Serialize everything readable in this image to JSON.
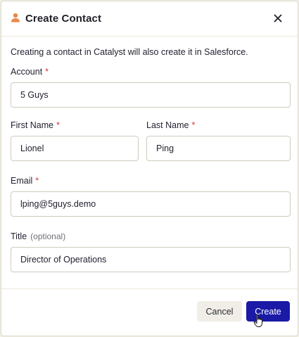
{
  "dialog": {
    "title": "Create Contact",
    "icons": {
      "header": "person-icon",
      "close": "close-icon"
    },
    "accent_color": "#e8894a"
  },
  "info_text": "Creating a contact in Catalyst will also create it in Salesforce.",
  "form": {
    "account": {
      "label": "Account",
      "required_mark": "*",
      "value": "5 Guys"
    },
    "first_name": {
      "label": "First Name",
      "required_mark": "*",
      "value": "Lionel"
    },
    "last_name": {
      "label": "Last Name",
      "required_mark": "*",
      "value": "Ping"
    },
    "email": {
      "label": "Email",
      "required_mark": "*",
      "value": "lping@5guys.demo"
    },
    "title": {
      "label": "Title",
      "optional_text": "(optional)",
      "value": "Director of Operations"
    }
  },
  "footer": {
    "cancel_label": "Cancel",
    "create_label": "Create",
    "create_color": "#1a1aa6"
  }
}
